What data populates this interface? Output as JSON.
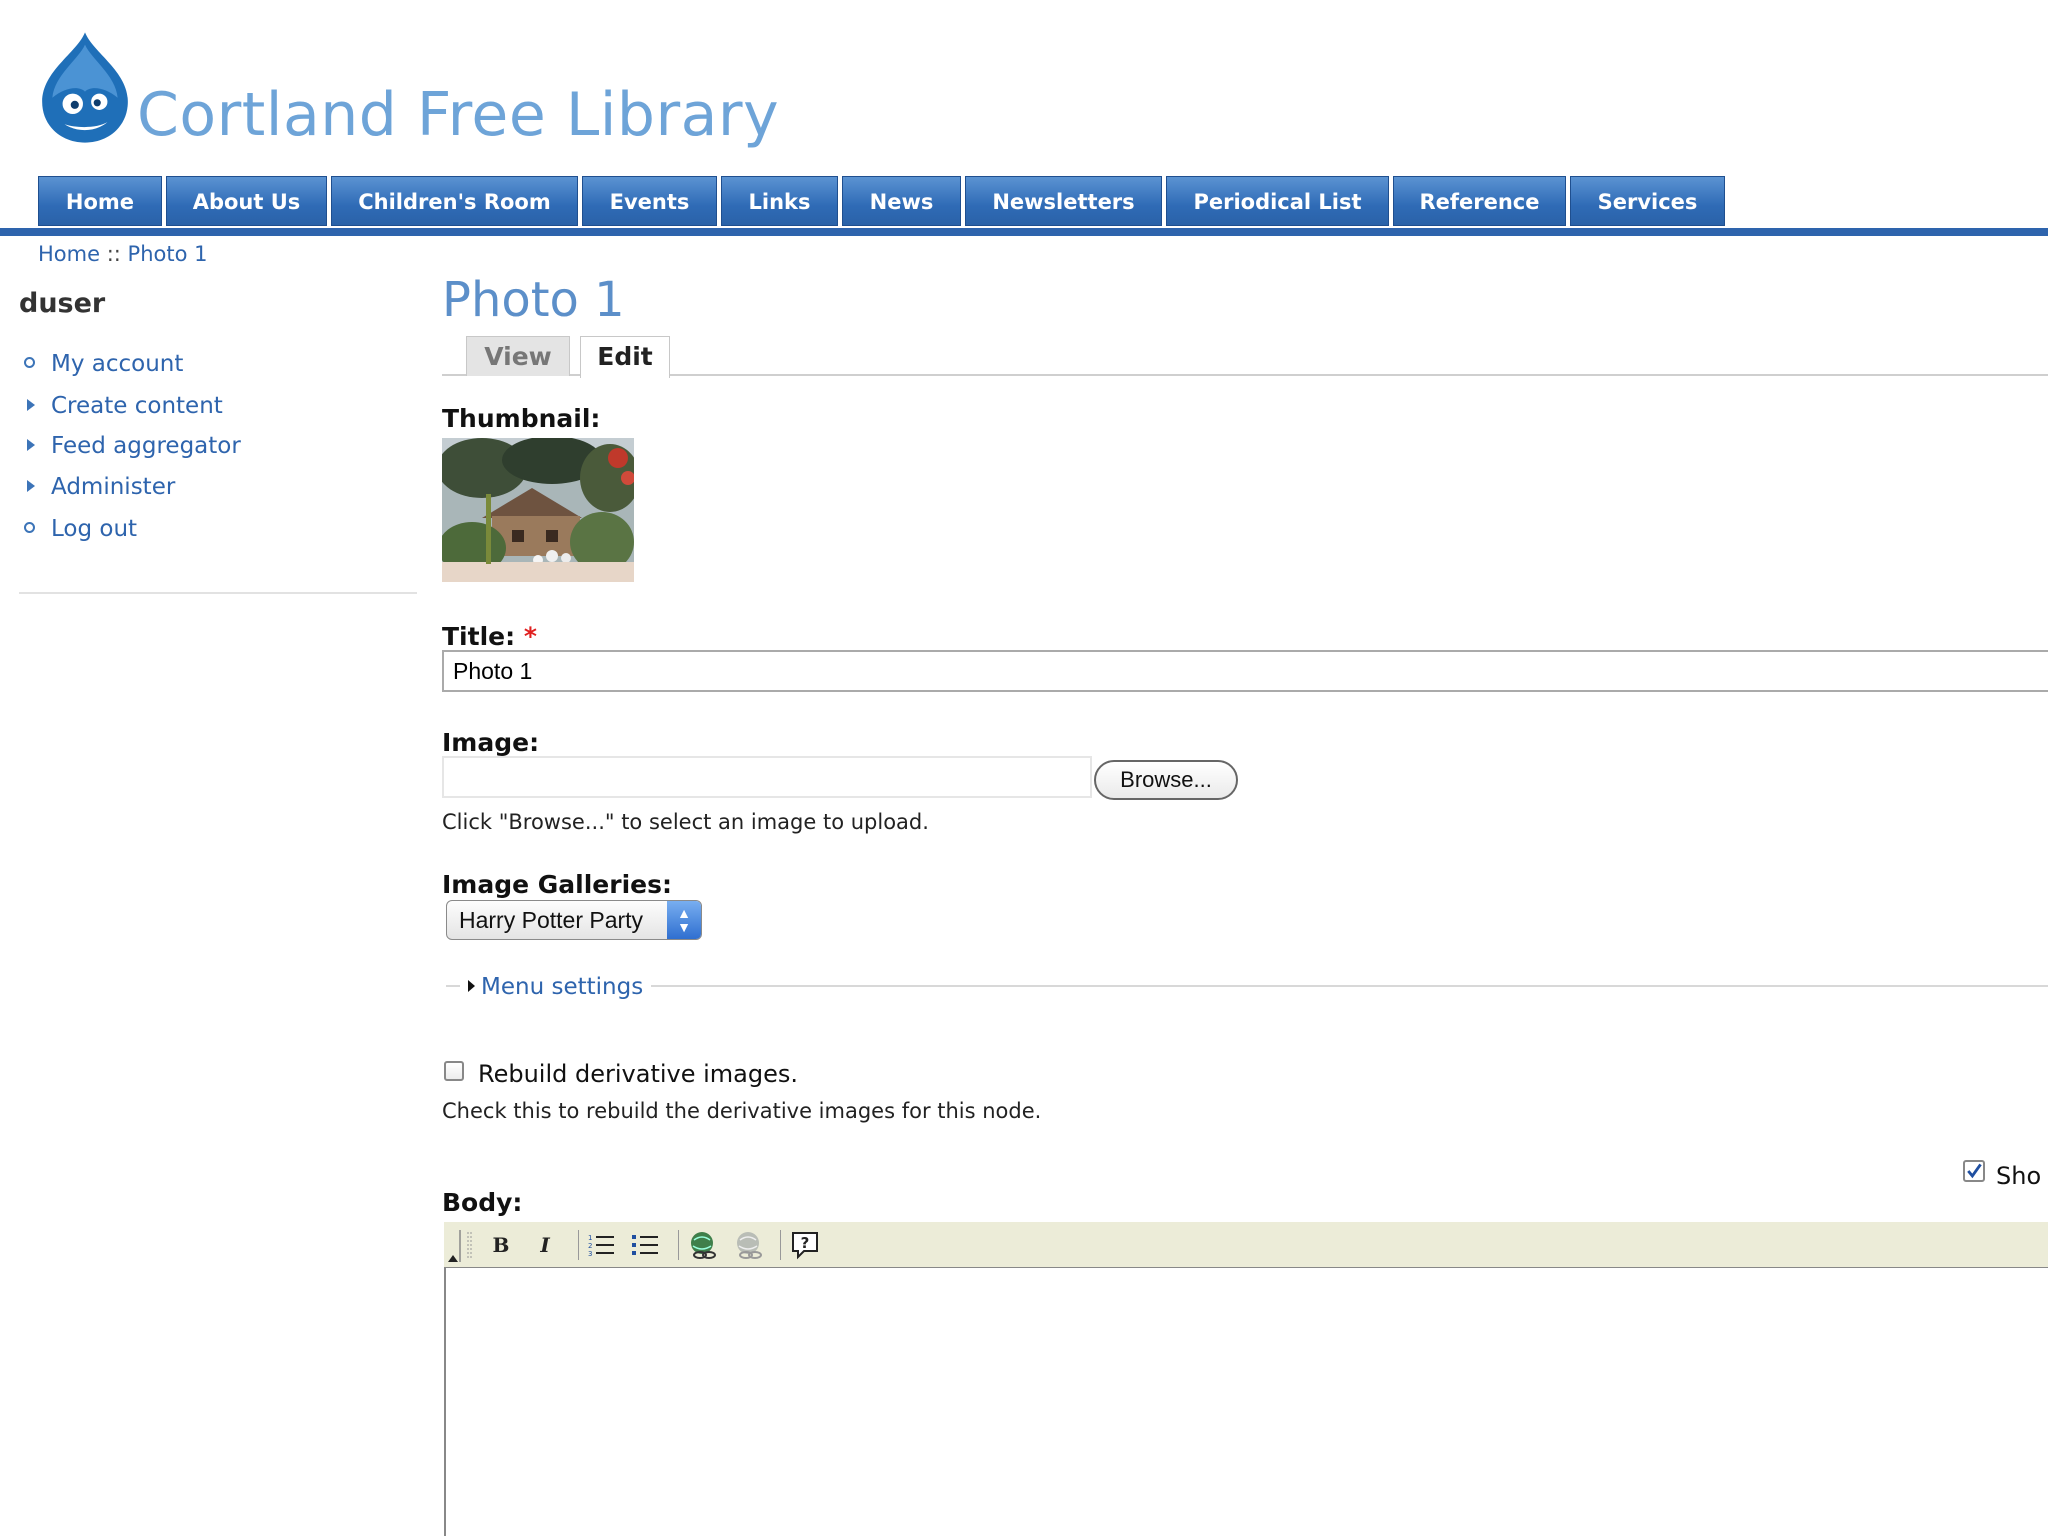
{
  "site": {
    "name": "Cortland Free Library",
    "logo_icon": "drupal-drop-icon"
  },
  "nav": {
    "items": [
      "Home",
      "About Us",
      "Children's Room",
      "Events",
      "Links",
      "News",
      "Newsletters",
      "Periodical List",
      "Reference",
      "Services"
    ]
  },
  "breadcrumb": {
    "home": "Home",
    "separator": "::",
    "current": "Photo 1"
  },
  "sidebar": {
    "user": "duser",
    "items": [
      {
        "label": "My account",
        "bullet": "circle"
      },
      {
        "label": "Create content",
        "bullet": "triangle"
      },
      {
        "label": "Feed aggregator",
        "bullet": "triangle"
      },
      {
        "label": "Administer",
        "bullet": "triangle"
      },
      {
        "label": "Log out",
        "bullet": "circle"
      }
    ]
  },
  "page": {
    "title": "Photo 1",
    "tabs": {
      "view": "View",
      "edit": "Edit"
    },
    "active_tab": "Edit"
  },
  "form": {
    "thumbnail_label": "Thumbnail:",
    "title_label": "Title:",
    "required_mark": "*",
    "title_value": "Photo 1",
    "image_label": "Image:",
    "browse_label": "Browse...",
    "image_help": "Click \"Browse...\" to select an image to upload.",
    "galleries_label": "Image Galleries:",
    "gallery_selected": "Harry Potter Party",
    "menu_settings": "Menu settings",
    "rebuild_label": "Rebuild derivative images.",
    "rebuild_checked": false,
    "rebuild_help": "Check this to rebuild the derivative images for this node.",
    "show_label": "Sho",
    "show_checked": true,
    "body_label": "Body:"
  },
  "colors": {
    "nav_blue": "#2e64ad",
    "title_blue": "#5c8fc9",
    "link_blue": "#2e64ad",
    "required_red": "#e02020"
  }
}
